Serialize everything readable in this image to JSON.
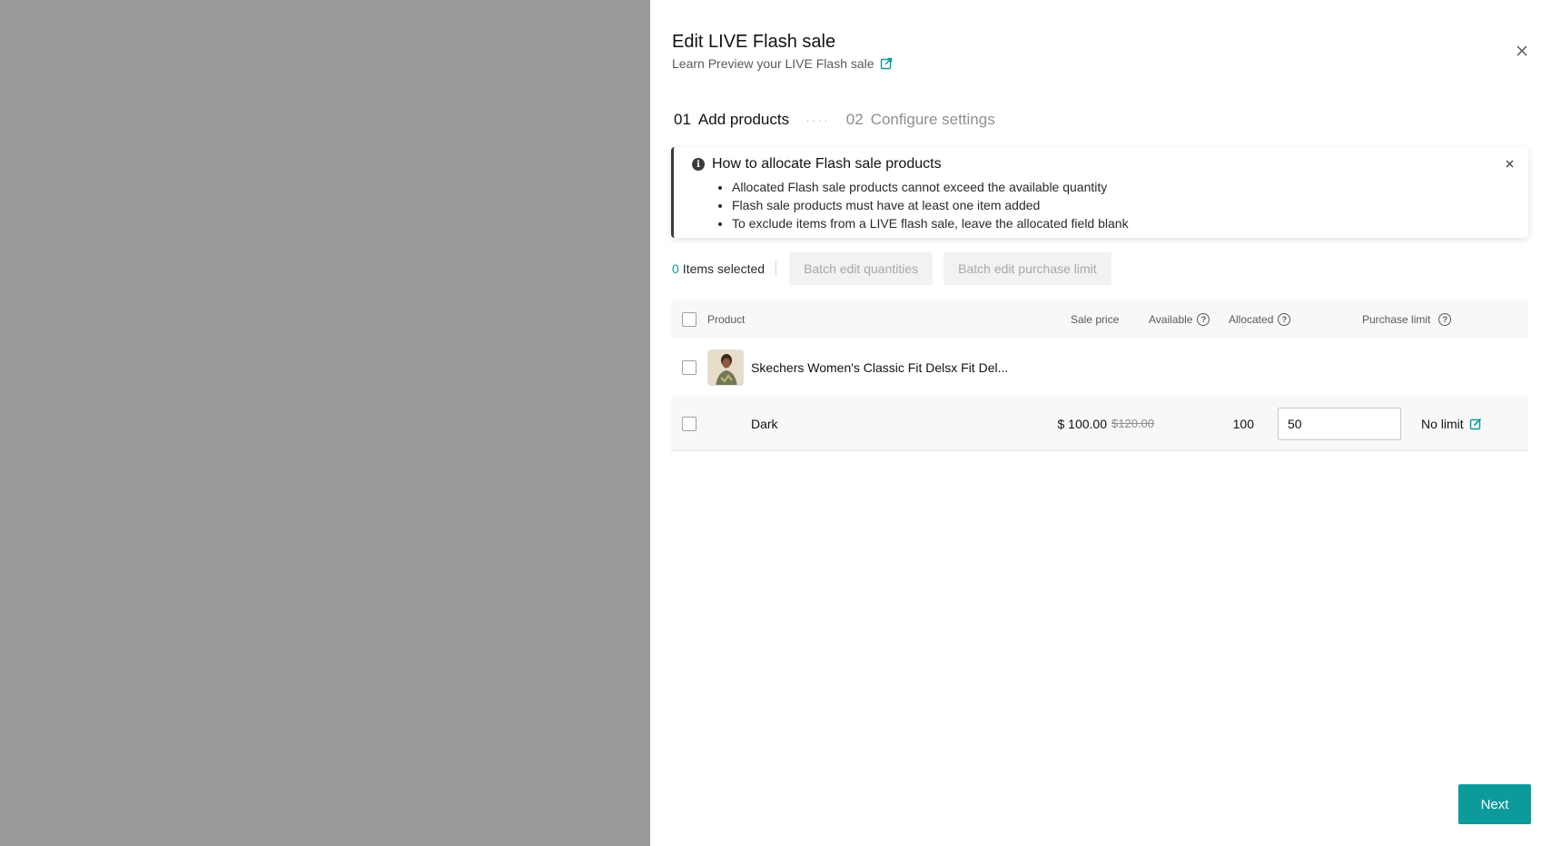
{
  "drawer": {
    "title": "Edit LIVE Flash sale",
    "subtitle": "Learn Preview your LIVE Flash sale"
  },
  "steps": [
    {
      "num": "01",
      "label": "Add products",
      "state": "active"
    },
    {
      "num": "02",
      "label": "Configure settings",
      "state": "inactive"
    }
  ],
  "notice": {
    "title": "How to allocate Flash sale products",
    "bullets": [
      "Allocated Flash sale products cannot exceed the available quantity",
      "Flash sale products must have at least one item added",
      "To exclude items from a LIVE flash sale, leave the allocated field blank"
    ]
  },
  "toolbar": {
    "selected_count": "0",
    "selected_label": "Items selected",
    "batch_quantities": "Batch edit quantities",
    "batch_limit": "Batch edit purchase limit"
  },
  "table": {
    "headers": {
      "product": "Product",
      "sale_price": "Sale price",
      "available": "Available",
      "allocated": "Allocated",
      "purchase_limit": "Purchase limit"
    },
    "product": {
      "name": "Skechers Women's Classic Fit Delsx Fit Del...",
      "variant": {
        "name": "Dark",
        "price": "$ 100.00",
        "original_price": "$120.00",
        "available": "100",
        "allocated": "50",
        "purchase_limit": "No limit"
      }
    }
  },
  "footer": {
    "next": "Next"
  },
  "colors": {
    "accent": "#0c9a9a",
    "overlay": "#999999"
  }
}
